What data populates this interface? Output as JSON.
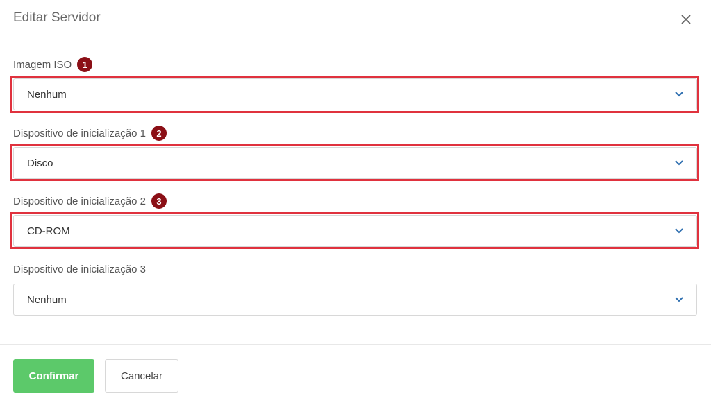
{
  "dialog": {
    "title": "Editar Servidor",
    "close_label": "×"
  },
  "fields": [
    {
      "label": "Imagem ISO",
      "badge": "1",
      "value": "Nenhum"
    },
    {
      "label": "Dispositivo de inicialização 1",
      "badge": "2",
      "value": "Disco"
    },
    {
      "label": "Dispositivo de inicialização 2",
      "badge": "3",
      "value": "CD-ROM"
    },
    {
      "label": "Dispositivo de inicialização 3",
      "value": "Nenhum"
    }
  ],
  "footer": {
    "confirm_label": "Confirmar",
    "cancel_label": "Cancelar"
  },
  "colors": {
    "confirm": "#5cc96a",
    "highlight": "#e0323e",
    "badge": "#8b0f16"
  }
}
